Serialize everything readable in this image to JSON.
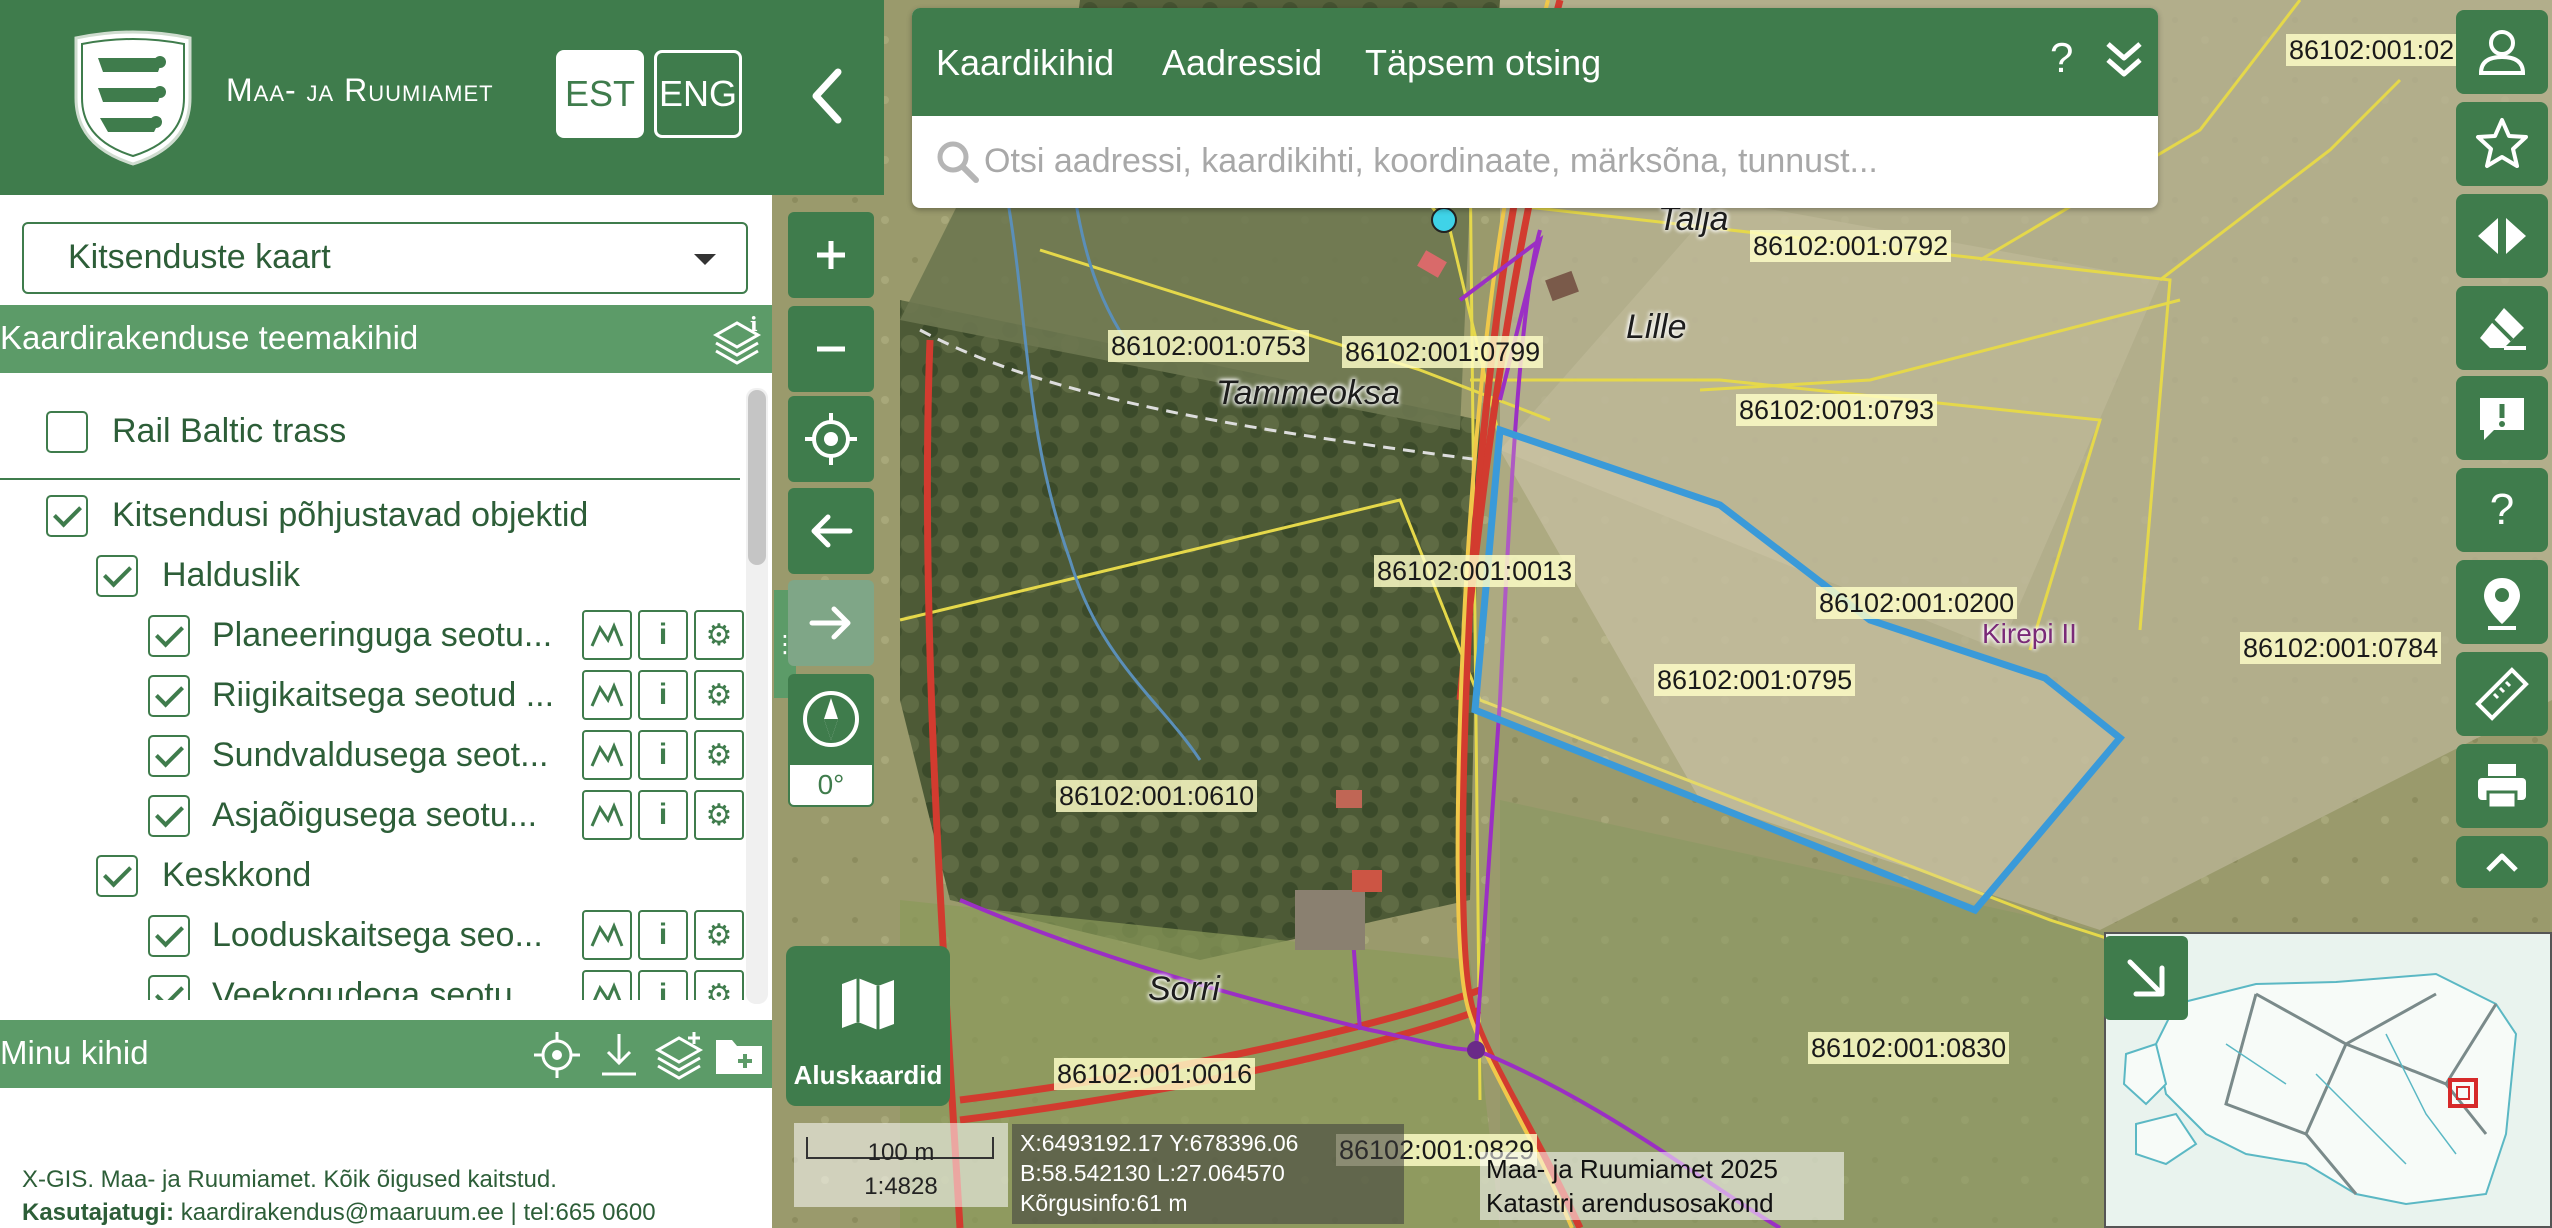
{
  "brand": {
    "org_name": "Maa- ja Ruumiamet",
    "lang_est": "EST",
    "lang_eng": "ENG"
  },
  "map_select": {
    "value": "Kitsenduste kaart"
  },
  "theme_section": {
    "title": "Kaardirakenduse teemakihid"
  },
  "layers": [
    {
      "label": "Rail Baltic trass",
      "checked": false
    },
    {
      "label": "Kitsendusi põhjustavad objektid",
      "checked": true
    },
    {
      "label": "Halduslik",
      "checked": true
    },
    {
      "label": "Planeeringuga seotu...",
      "checked": true
    },
    {
      "label": "Riigikaitsega seotud ...",
      "checked": true
    },
    {
      "label": "Sundvaldusega seot...",
      "checked": true
    },
    {
      "label": "Asjaõigusega seotu...",
      "checked": true
    },
    {
      "label": "Keskkond",
      "checked": true
    },
    {
      "label": "Looduskaitsega seo...",
      "checked": true
    },
    {
      "label": "Veekogudega seotu...",
      "checked": true
    }
  ],
  "my_layers": {
    "title": "Minu kihid"
  },
  "footer": {
    "copyright": "X-GIS. Maa- ja Ruumiamet. Kõik õigused kaitstud.",
    "support_label": "Kasutajatugi:",
    "support_contact": "kaardirakendus@maaruum.ee | tel:665 0600"
  },
  "search": {
    "tabs": [
      "Kaardikihid",
      "Aadressid",
      "Täpsem otsing"
    ],
    "help": "?",
    "placeholder": "Otsi aadressi, kaardikihti, koordinaate, märksõna, tunnust..."
  },
  "rotation": "0°",
  "basemap_label": "Aluskaardid",
  "scale": {
    "distance": "100 m",
    "ratio": "1:4828"
  },
  "coordinates": {
    "xy": "X:6493192.17 Y:678396.06",
    "bl": "B:58.542130 L:27.064570",
    "height": "Kõrgusinfo:61 m"
  },
  "attribution": {
    "line1": "Maa- ja Ruumiamet 2025",
    "line2": "Katastri arendusosakond"
  },
  "parcels": [
    "86102:001:0792",
    "86102:001:0753",
    "86102:001:0799",
    "86102:001:0793",
    "86102:001:0013",
    "86102:001:0200",
    "86102:001:0795",
    "86102:001:0784",
    "86102:001:0610",
    "86102:001:0016",
    "86102:001:0830",
    "86102:001:0829",
    "86102:001:02"
  ],
  "place_names": [
    "Talja",
    "Lille",
    "Tammeoksa",
    "Kirepi II",
    "Sorri"
  ],
  "colors": {
    "brand_green": "#3f7c4c",
    "section_green": "#5c9b68",
    "parcel_outline": "#e5d84a",
    "selected_parcel": "#3a9ad9",
    "road": "#d23b2f",
    "power_line": "#9b2fc4"
  }
}
